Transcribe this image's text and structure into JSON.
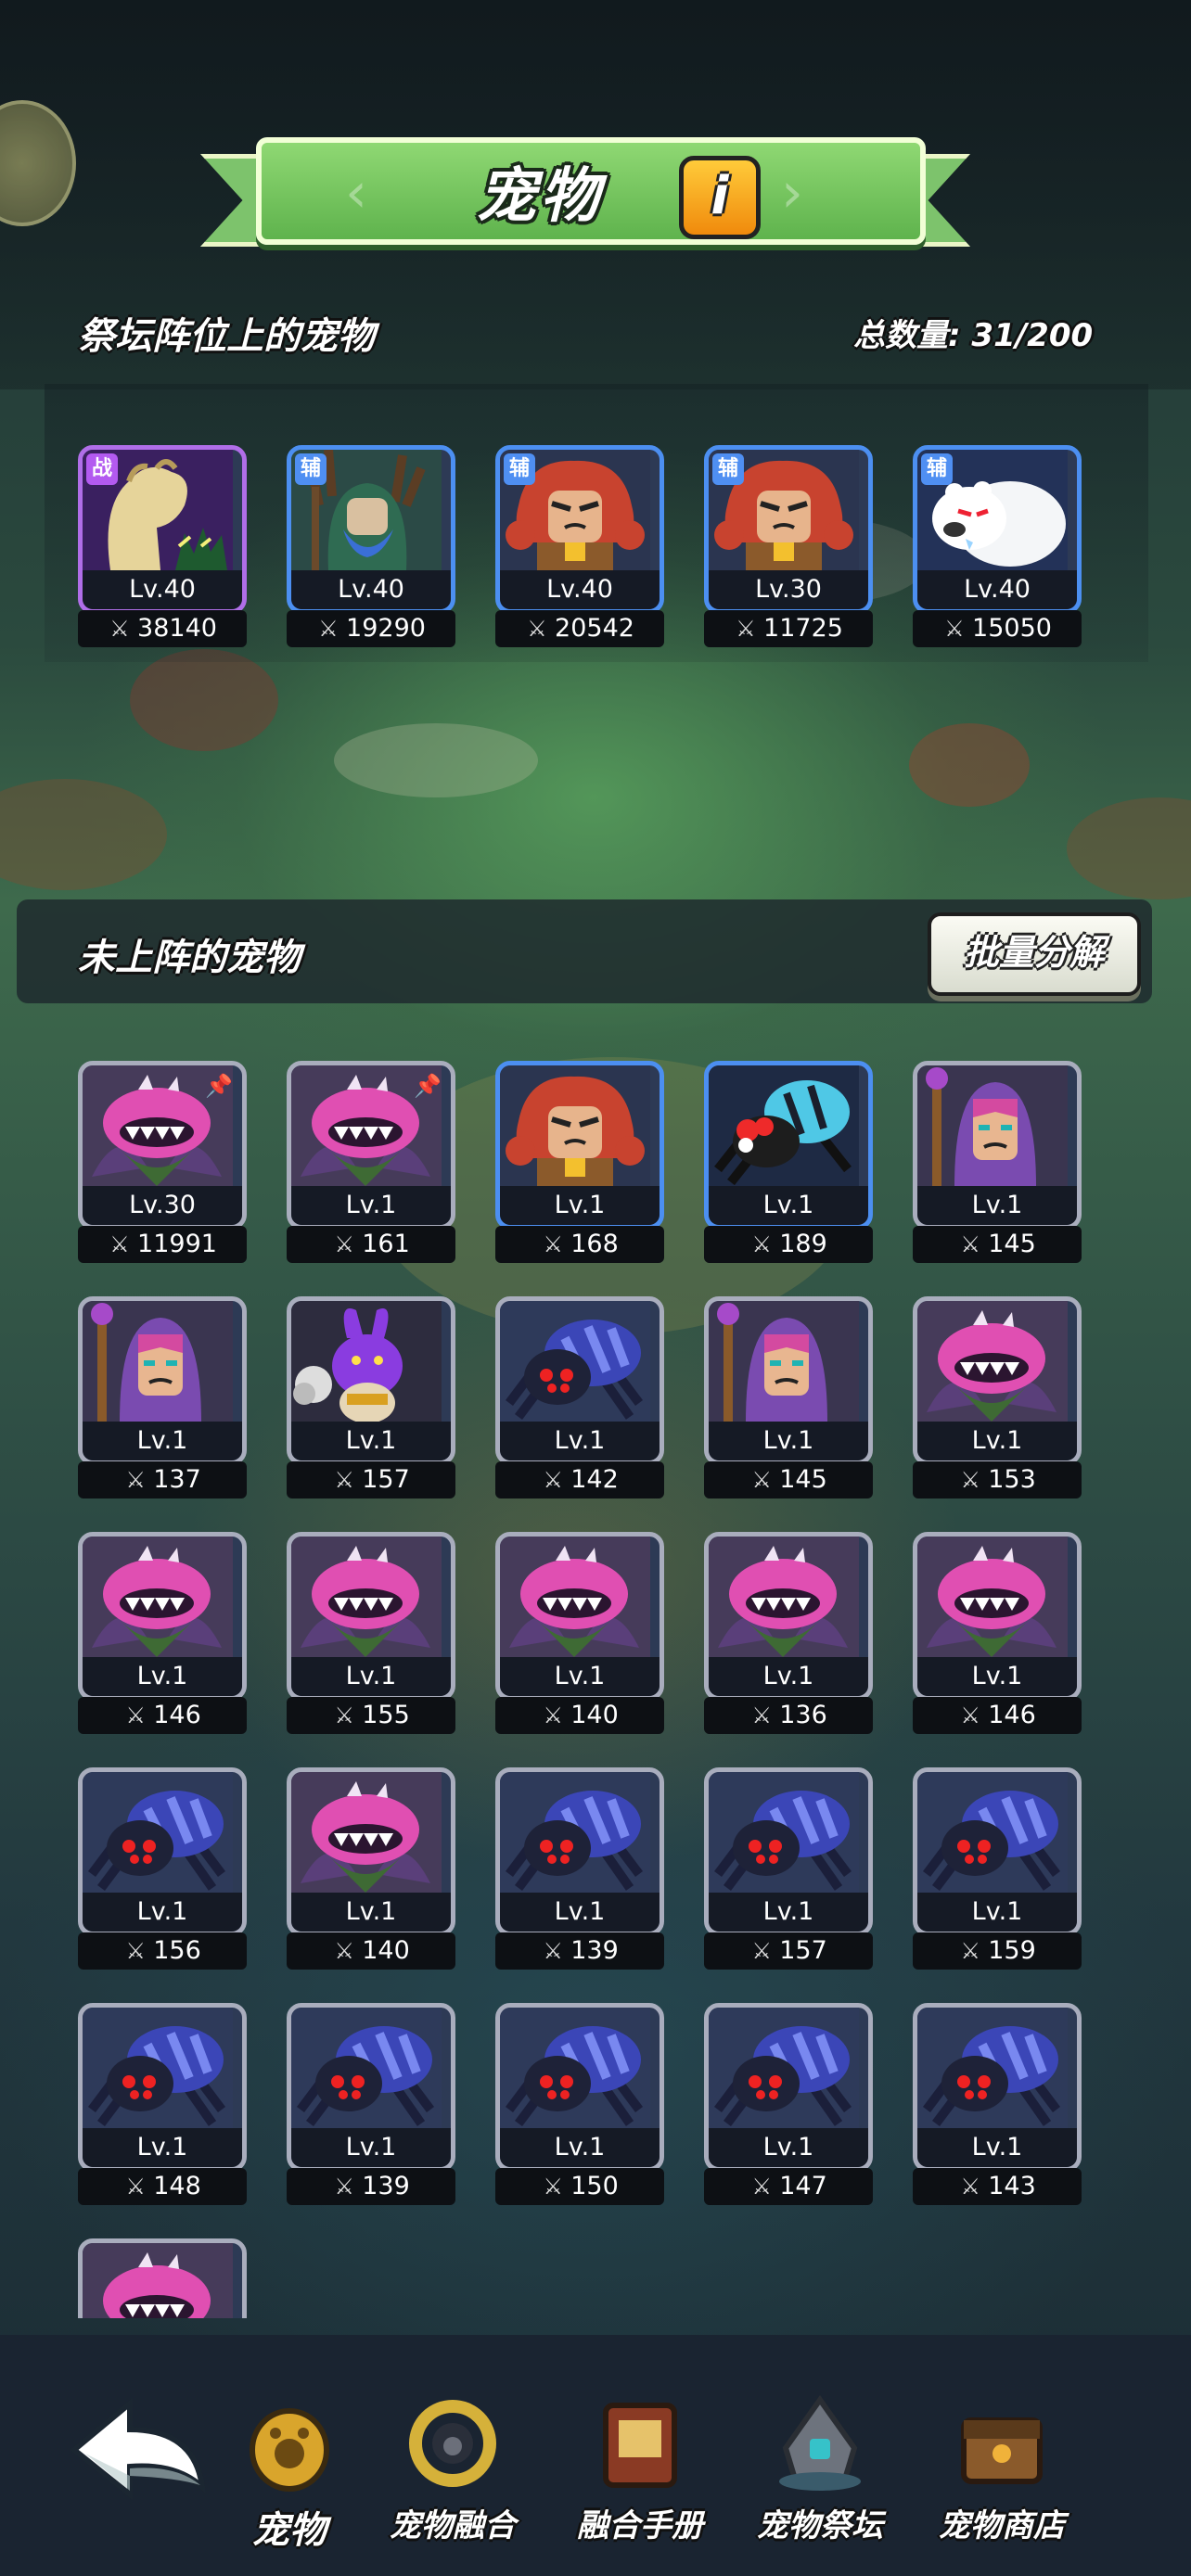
{
  "header": {
    "title": "宠物",
    "info_icon": "info-icon",
    "info_glyph": "i"
  },
  "altar": {
    "label": "祭坛阵位上的宠物",
    "total_label": "总数量: 31/200",
    "pets": [
      {
        "badge": "战",
        "role": "zhan",
        "rarity": "purple",
        "creature": "dragon-hand",
        "level": "Lv.40",
        "power": "38140"
      },
      {
        "badge": "辅",
        "role": "fu",
        "rarity": "blue",
        "creature": "tree-druid",
        "level": "Lv.40",
        "power": "19290"
      },
      {
        "badge": "辅",
        "role": "fu",
        "rarity": "blue",
        "creature": "red-hair-warrior",
        "level": "Lv.40",
        "power": "20542"
      },
      {
        "badge": "辅",
        "role": "fu",
        "rarity": "blue",
        "creature": "red-hair-warrior",
        "level": "Lv.30",
        "power": "11725"
      },
      {
        "badge": "辅",
        "role": "fu",
        "rarity": "blue",
        "creature": "polar-bear",
        "level": "Lv.40",
        "power": "15050"
      }
    ]
  },
  "undeployed": {
    "label": "未上阵的宠物",
    "batch_button": "批量分解",
    "pets": [
      {
        "rarity": "gray",
        "creature": "piranha-plant",
        "pinned": true,
        "level": "Lv.30",
        "power": "11991"
      },
      {
        "rarity": "gray",
        "creature": "piranha-plant",
        "pinned": true,
        "level": "Lv.1",
        "power": "161"
      },
      {
        "rarity": "blue",
        "creature": "red-hair-warrior",
        "level": "Lv.1",
        "power": "168"
      },
      {
        "rarity": "blue",
        "creature": "cyan-spider",
        "level": "Lv.1",
        "power": "189"
      },
      {
        "rarity": "gray",
        "creature": "purple-mage",
        "level": "Lv.1",
        "power": "145"
      },
      {
        "rarity": "gray",
        "creature": "purple-mage",
        "level": "Lv.1",
        "power": "137"
      },
      {
        "rarity": "gray",
        "creature": "purple-beast",
        "level": "Lv.1",
        "power": "157"
      },
      {
        "rarity": "gray",
        "creature": "blue-spider",
        "level": "Lv.1",
        "power": "142"
      },
      {
        "rarity": "gray",
        "creature": "purple-mage",
        "level": "Lv.1",
        "power": "145"
      },
      {
        "rarity": "gray",
        "creature": "piranha-plant",
        "level": "Lv.1",
        "power": "153"
      },
      {
        "rarity": "gray",
        "creature": "piranha-plant",
        "level": "Lv.1",
        "power": "146"
      },
      {
        "rarity": "gray",
        "creature": "piranha-plant",
        "level": "Lv.1",
        "power": "155"
      },
      {
        "rarity": "gray",
        "creature": "piranha-plant",
        "level": "Lv.1",
        "power": "140"
      },
      {
        "rarity": "gray",
        "creature": "piranha-plant",
        "level": "Lv.1",
        "power": "136"
      },
      {
        "rarity": "gray",
        "creature": "piranha-plant",
        "level": "Lv.1",
        "power": "146"
      },
      {
        "rarity": "gray",
        "creature": "blue-spider",
        "level": "Lv.1",
        "power": "156"
      },
      {
        "rarity": "gray",
        "creature": "piranha-plant",
        "level": "Lv.1",
        "power": "140"
      },
      {
        "rarity": "gray",
        "creature": "blue-spider",
        "level": "Lv.1",
        "power": "139"
      },
      {
        "rarity": "gray",
        "creature": "blue-spider",
        "level": "Lv.1",
        "power": "157"
      },
      {
        "rarity": "gray",
        "creature": "blue-spider",
        "level": "Lv.1",
        "power": "159"
      },
      {
        "rarity": "gray",
        "creature": "blue-spider",
        "level": "Lv.1",
        "power": "148"
      },
      {
        "rarity": "gray",
        "creature": "blue-spider",
        "level": "Lv.1",
        "power": "139"
      },
      {
        "rarity": "gray",
        "creature": "blue-spider",
        "level": "Lv.1",
        "power": "150"
      },
      {
        "rarity": "gray",
        "creature": "blue-spider",
        "level": "Lv.1",
        "power": "147"
      },
      {
        "rarity": "gray",
        "creature": "blue-spider",
        "level": "Lv.1",
        "power": "143"
      },
      {
        "rarity": "gray",
        "creature": "piranha-plant",
        "level": "",
        "power": ""
      }
    ]
  },
  "nav": {
    "back_icon": "back-arrow-icon",
    "items": [
      {
        "label": "宠物",
        "icon": "pet-egg-icon",
        "active": true
      },
      {
        "label": "宠物融合",
        "icon": "fusion-icon",
        "active": false
      },
      {
        "label": "融合手册",
        "icon": "handbook-icon",
        "active": false
      },
      {
        "label": "宠物祭坛",
        "icon": "altar-icon",
        "active": false
      },
      {
        "label": "宠物商店",
        "icon": "shop-chest-icon",
        "active": false
      }
    ]
  },
  "colors": {
    "rarity_gray": "#a9adbd",
    "rarity_blue": "#4c8ff1",
    "rarity_purple": "#b06ee8",
    "title_green": "#7dc36c",
    "info_orange": "#f5a11f"
  }
}
